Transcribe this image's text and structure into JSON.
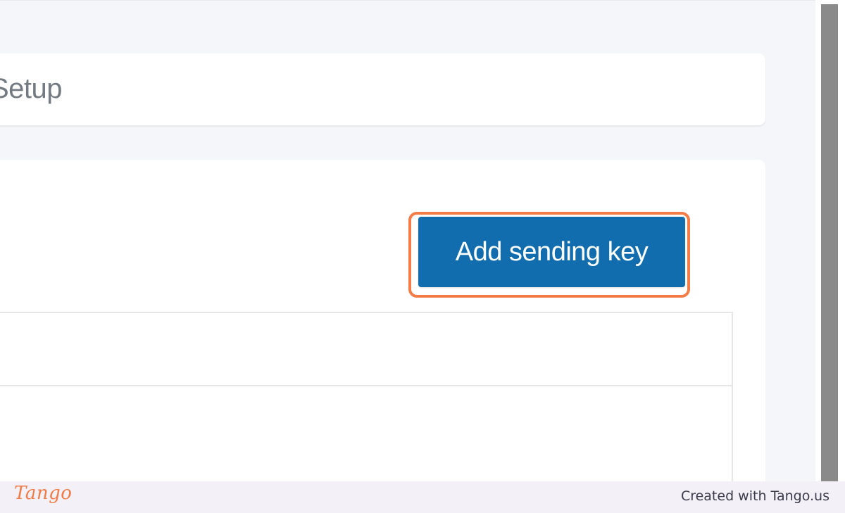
{
  "header": {
    "title": "Setup"
  },
  "main": {
    "add_button_label": "Add sending key"
  },
  "footer": {
    "logo_text": "Tango",
    "credit": "Created with Tango.us"
  },
  "colors": {
    "primary_button": "#116dad",
    "highlight": "#f37c48",
    "background": "#f4f6f9"
  }
}
